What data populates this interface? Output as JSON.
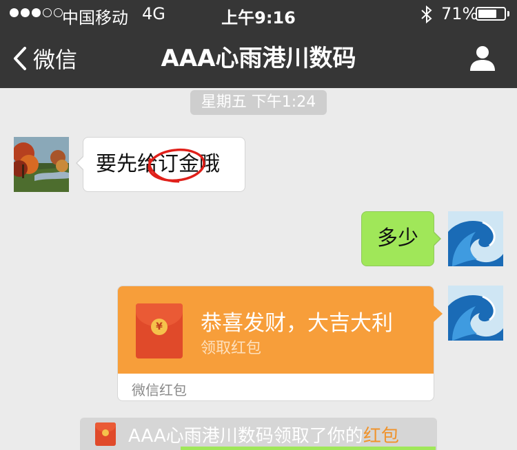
{
  "status_bar": {
    "carrier": "中国移动",
    "network": "4G",
    "time": "上午9:16",
    "battery_percent": "71%",
    "battery_level": 0.71,
    "signal_bars_filled": 3,
    "signal_bars_total": 5
  },
  "nav": {
    "back_label": "微信",
    "title": "AAA心雨港川数码"
  },
  "chat": {
    "timestamp": "星期五 下午1:24",
    "messages": [
      {
        "from": "contact",
        "text": "要先给订金哦"
      },
      {
        "from": "me",
        "text": "多少"
      }
    ],
    "red_packet": {
      "title": "恭喜发财，大吉大利",
      "subtitle": "领取红包",
      "footer": "微信红包",
      "coin_symbol": "¥"
    },
    "notice": {
      "text": "AAA心雨港川数码领取了你的",
      "highlight": "红包"
    }
  },
  "colors": {
    "nav_bg": "#363636",
    "chat_bg": "#ebebeb",
    "outgoing_bubble": "#a0e759",
    "red_packet": "#f79e3a",
    "highlight": "#f0932b",
    "annotation_circle": "#e0201a"
  },
  "icons": {
    "back": "chevron-left-icon",
    "profile": "person-icon",
    "bluetooth": "bluetooth-icon",
    "red_packet": "red-envelope-icon"
  }
}
